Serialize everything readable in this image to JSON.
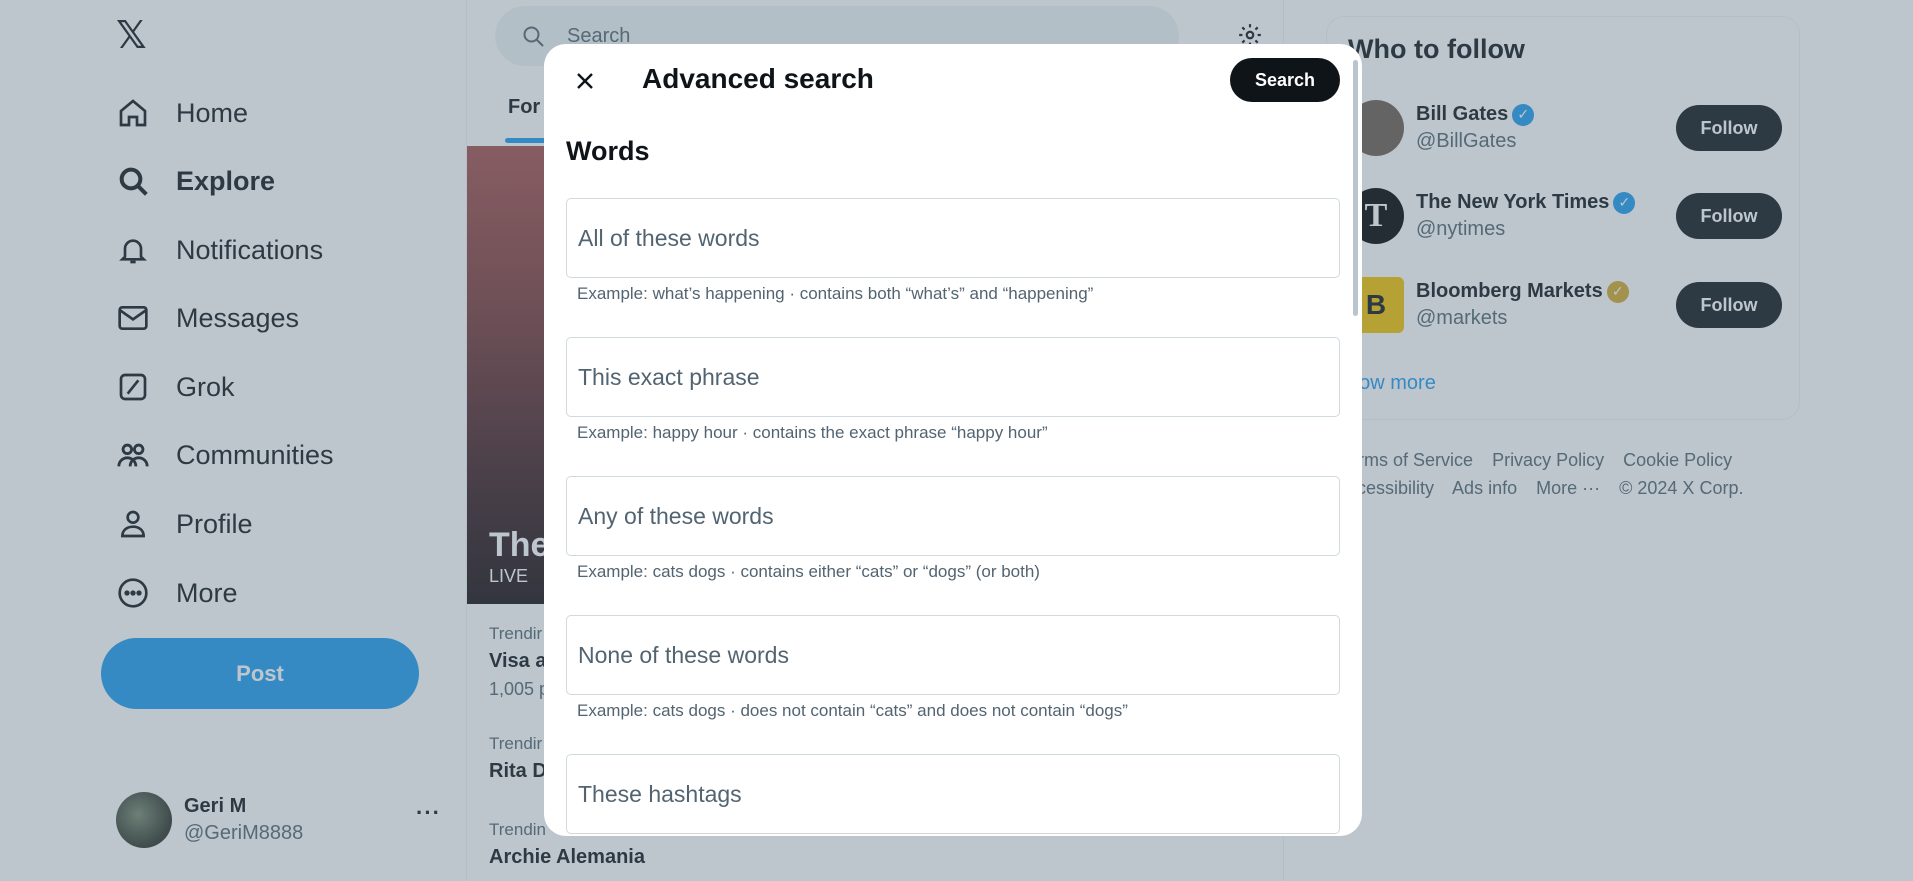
{
  "leftnav": {
    "logo": "𝕏",
    "items": [
      {
        "label": "Home",
        "icon": "home-icon"
      },
      {
        "label": "Explore",
        "icon": "search-icon"
      },
      {
        "label": "Notifications",
        "icon": "bell-icon"
      },
      {
        "label": "Messages",
        "icon": "envelope-icon"
      },
      {
        "label": "Grok",
        "icon": "grok-icon"
      },
      {
        "label": "Communities",
        "icon": "people-icon"
      },
      {
        "label": "Profile",
        "icon": "person-icon"
      },
      {
        "label": "More",
        "icon": "more-circle-icon"
      }
    ],
    "post_label": "Post",
    "user": {
      "name": "Geri M",
      "handle": "@GeriM8888",
      "more": "···"
    }
  },
  "middle": {
    "search_placeholder": "Search",
    "tab": "For",
    "hero_title": "The",
    "hero_live": "LIVE",
    "trends": [
      {
        "category": "Trendir",
        "name": "Visa a",
        "count": "1,005 p"
      },
      {
        "category": "Trendir",
        "name": "Rita D",
        "count": ""
      },
      {
        "category": "Trendin",
        "name": "Archie Alemania",
        "count": ""
      }
    ]
  },
  "right": {
    "title": "Who to follow",
    "follows": [
      {
        "name": "Bill Gates",
        "handle": "@BillGates",
        "badge": "blue",
        "avatar_color": "#6b5d52"
      },
      {
        "name": "The New York Times",
        "handle": "@nytimes",
        "badge": "blue",
        "avatar_color": "#000000"
      },
      {
        "name": "Bloomberg Markets",
        "handle": "@markets",
        "badge": "gold",
        "avatar_color": "#f2c200"
      }
    ],
    "follow_label": "Follow",
    "show_more": "how more",
    "footer": [
      "erms of Service",
      "Privacy Policy",
      "Cookie Policy",
      "ccessibility",
      "Ads info",
      "More ···",
      "© 2024 X Corp."
    ]
  },
  "modal": {
    "title": "Advanced search",
    "search_button": "Search",
    "section_title": "Words",
    "fields": [
      {
        "placeholder": "All of these words",
        "hint": "Example: what’s happening · contains both “what’s” and “happening”"
      },
      {
        "placeholder": "This exact phrase",
        "hint": "Example: happy hour · contains the exact phrase “happy hour”"
      },
      {
        "placeholder": "Any of these words",
        "hint": "Example: cats dogs · contains either “cats” or “dogs” (or both)"
      },
      {
        "placeholder": "None of these words",
        "hint": "Example: cats dogs · does not contain “cats” and does not contain “dogs”"
      },
      {
        "placeholder": "These hashtags",
        "hint": ""
      }
    ]
  }
}
